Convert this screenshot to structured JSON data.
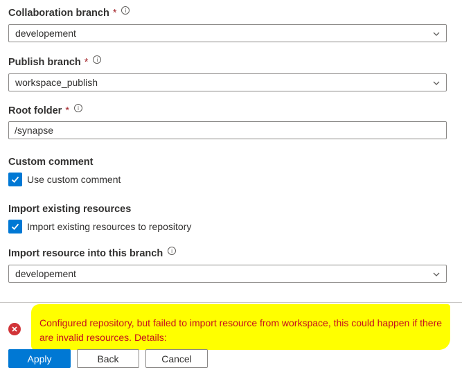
{
  "collaboration_branch": {
    "label": "Collaboration branch",
    "required_mark": "*",
    "value": "developement"
  },
  "publish_branch": {
    "label": "Publish branch",
    "required_mark": "*",
    "value": "workspace_publish"
  },
  "root_folder": {
    "label": "Root folder",
    "required_mark": "*",
    "value": "/synapse"
  },
  "custom_comment": {
    "title": "Custom comment",
    "checkbox_label": "Use custom comment",
    "checked": true
  },
  "import_existing": {
    "title": "Import existing resources",
    "checkbox_label": "Import existing resources to repository",
    "checked": true
  },
  "import_branch": {
    "label": "Import resource into this branch",
    "value": "developement"
  },
  "info_glyph": "i",
  "error": {
    "message": "Configured repository, but failed to import resource from workspace, this could happen if there are invalid resources. Details:",
    "icon": "error-circle-icon",
    "color": "#d13438"
  },
  "buttons": {
    "apply": "Apply",
    "back": "Back",
    "cancel": "Cancel"
  },
  "colors": {
    "accent": "#0078d4",
    "highlight": "#ffff00",
    "error_text": "#c50f1f"
  }
}
